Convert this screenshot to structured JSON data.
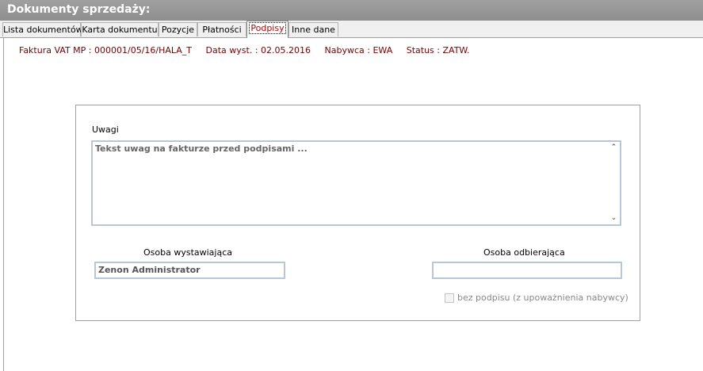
{
  "window": {
    "title": "Dokumenty sprzedaży:"
  },
  "tabs": [
    {
      "label": "Lista dokumentów"
    },
    {
      "label": "Karta dokumentu"
    },
    {
      "label": "Pozycje"
    },
    {
      "label": "Płatności"
    },
    {
      "label": "Podpisy",
      "active": true
    },
    {
      "label": "Inne dane"
    }
  ],
  "info": {
    "document": "Faktura VAT MP : 000001/05/16/HALA_T",
    "date": "Data wyst. : 02.05.2016",
    "buyer": "Nabywca : EWA",
    "status": "Status : ZATW."
  },
  "notes": {
    "label": "Uwagi",
    "value": "Tekst uwag na fakturze przed podpisami ..."
  },
  "issuer": {
    "label": "Osoba wystawiająca",
    "value": "Zenon Administrator"
  },
  "receiver": {
    "label": "Osoba odbierająca",
    "value": ""
  },
  "no_signature": {
    "label": "bez podpisu (z upoważnienia nabywcy)",
    "checked": false
  },
  "colors": {
    "title_bar": "#8e8e8e",
    "active_tab_text": "#c00000",
    "info_text": "#7a0000",
    "field_border": "#b8c7d8"
  }
}
